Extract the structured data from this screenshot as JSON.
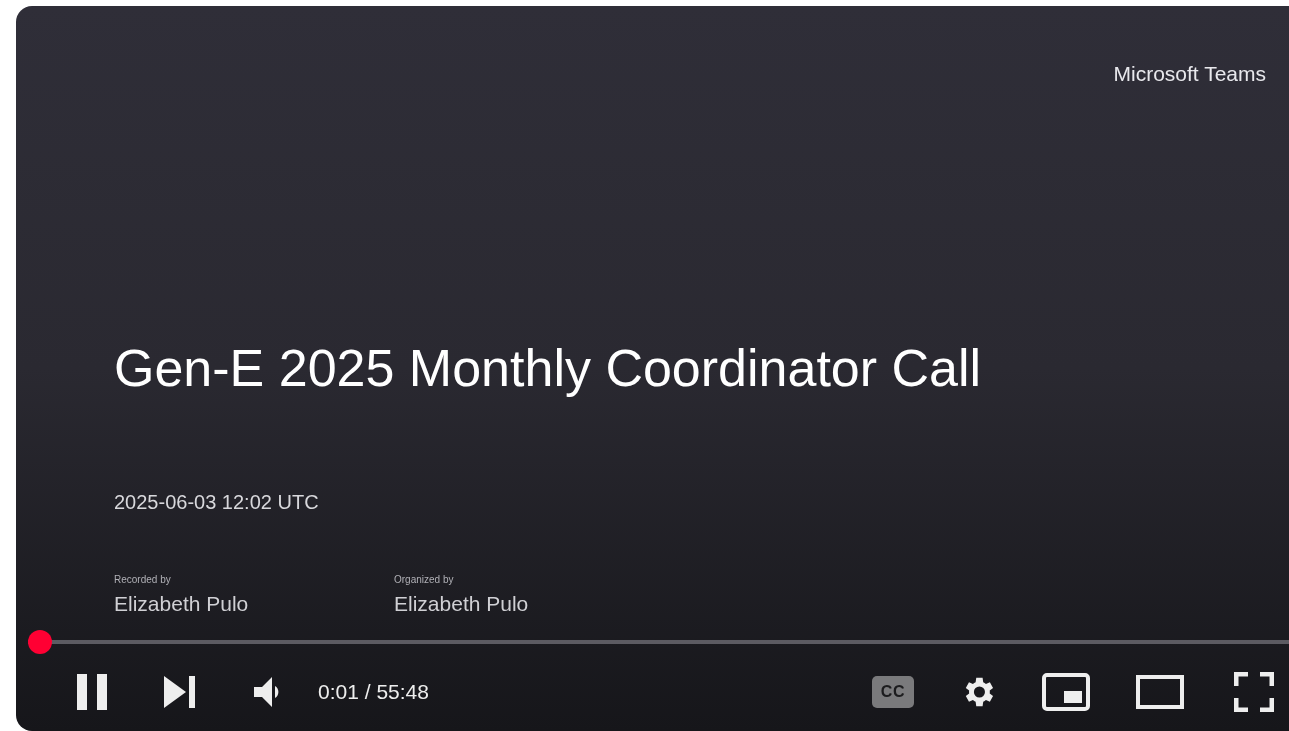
{
  "slide": {
    "brand": "Microsoft Teams",
    "title": "Gen-E 2025 Monthly Coordinator Call",
    "date": "2025-06-03 12:02 UTC",
    "credits": [
      {
        "label": "Recorded by",
        "name": "Elizabeth Pulo"
      },
      {
        "label": "Organized by",
        "name": "Elizabeth Pulo"
      }
    ]
  },
  "player": {
    "progress": {
      "level": 0
    },
    "playing": true,
    "time": "0:01 / 55:48",
    "captions": {
      "label": "CC",
      "on": false
    }
  }
}
